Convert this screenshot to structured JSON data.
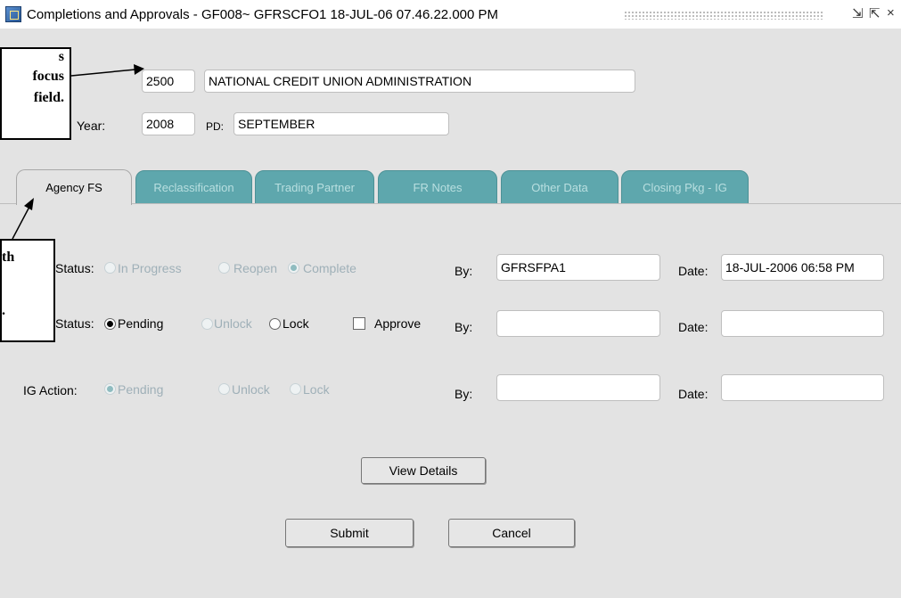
{
  "window": {
    "title": "Completions and Approvals - GF008~ GFRSCFO1  18-JUL-06 07.46.22.000 PM",
    "controls": [
      "⇲",
      "⇱",
      "×"
    ]
  },
  "header": {
    "agency_code": "2500",
    "agency_name": "NATIONAL CREDIT UNION ADMINISTRATION",
    "year_label": "Year:",
    "year_value": "2008",
    "pd_label": "PD:",
    "pd_value": "SEPTEMBER"
  },
  "tabs": [
    {
      "label": "Agency FS",
      "active": true
    },
    {
      "label": "Reclassification",
      "active": false
    },
    {
      "label": "Trading Partner",
      "active": false
    },
    {
      "label": "FR Notes",
      "active": false
    },
    {
      "label": "Other Data",
      "active": false
    },
    {
      "label": "Closing Pkg - IG",
      "active": false
    }
  ],
  "rows": {
    "completion": {
      "label": "Status:",
      "options": [
        "In Progress",
        "Reopen",
        "Complete"
      ],
      "selected": "Complete",
      "enabled": false,
      "by_label": "By:",
      "by_value": "GFRSFPA1",
      "date_label": "Date:",
      "date_value": "18-JUL-2006 06:58 PM"
    },
    "approval": {
      "label": "Status:",
      "options": [
        "Pending",
        "Unlock",
        "Lock"
      ],
      "selected": "Pending",
      "approve_label": "Approve",
      "by_label": "By:",
      "by_value": "",
      "date_label": "Date:",
      "date_value": ""
    },
    "ig_action": {
      "label": "IG Action:",
      "options": [
        "Pending",
        "Unlock",
        "Lock"
      ],
      "selected": "Pending",
      "enabled": false,
      "by_label": "By:",
      "by_value": "",
      "date_label": "Date:",
      "date_value": ""
    }
  },
  "buttons": {
    "view_details": "View Details",
    "submit": "Submit",
    "cancel": "Cancel"
  },
  "callouts": {
    "top": {
      "lines": [
        "s",
        "focus",
        "field."
      ]
    },
    "left": {
      "lines": [
        "th",
        "",
        "."
      ]
    }
  },
  "colors": {
    "form_bg": "#e3e3e3",
    "inactive_tab": "#5ea7ad",
    "disabled_text": "#9fb0b8"
  }
}
